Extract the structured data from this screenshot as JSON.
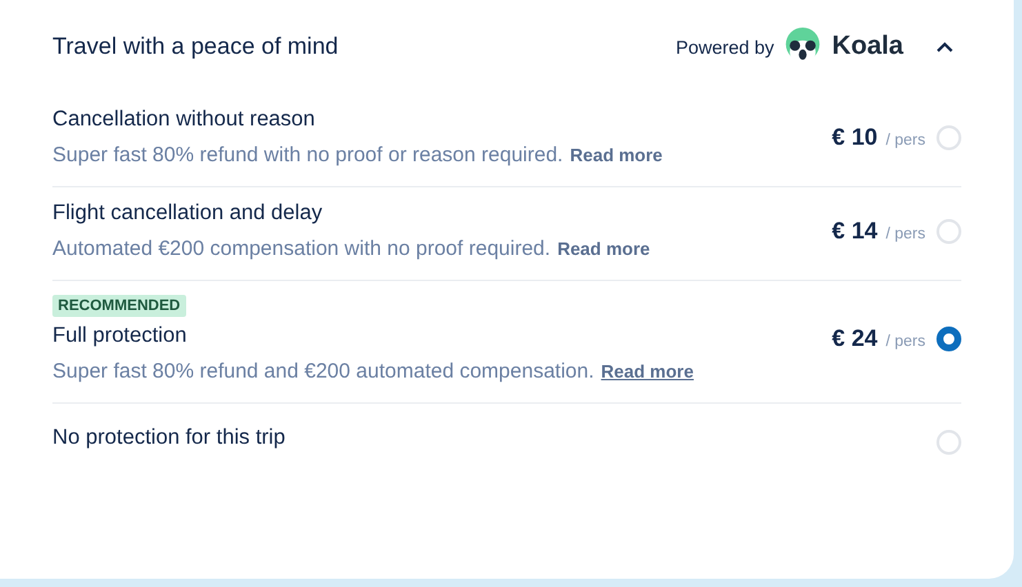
{
  "header": {
    "title": "Travel with a peace of mind",
    "powered_by": "Powered by",
    "brand": "Koala",
    "expanded": true
  },
  "options": [
    {
      "title": "Cancellation without reason",
      "description": "Super fast 80% refund with no proof or reason required.",
      "link": "Read more",
      "price": "€ 10",
      "unit": "/ pers",
      "selected": false
    },
    {
      "title": "Flight cancellation and delay",
      "description": "Automated €200 compensation with no proof required.",
      "link": "Read more",
      "price": "€ 14",
      "unit": "/ pers",
      "selected": false
    },
    {
      "badge": "RECOMMENDED",
      "title": "Full protection",
      "description": "Super fast 80% refund and €200 automated compensation.",
      "link": "Read more",
      "price": "€ 24",
      "unit": "/ pers",
      "selected": true
    },
    {
      "title": "No protection for this trip",
      "selected": false
    }
  ]
}
